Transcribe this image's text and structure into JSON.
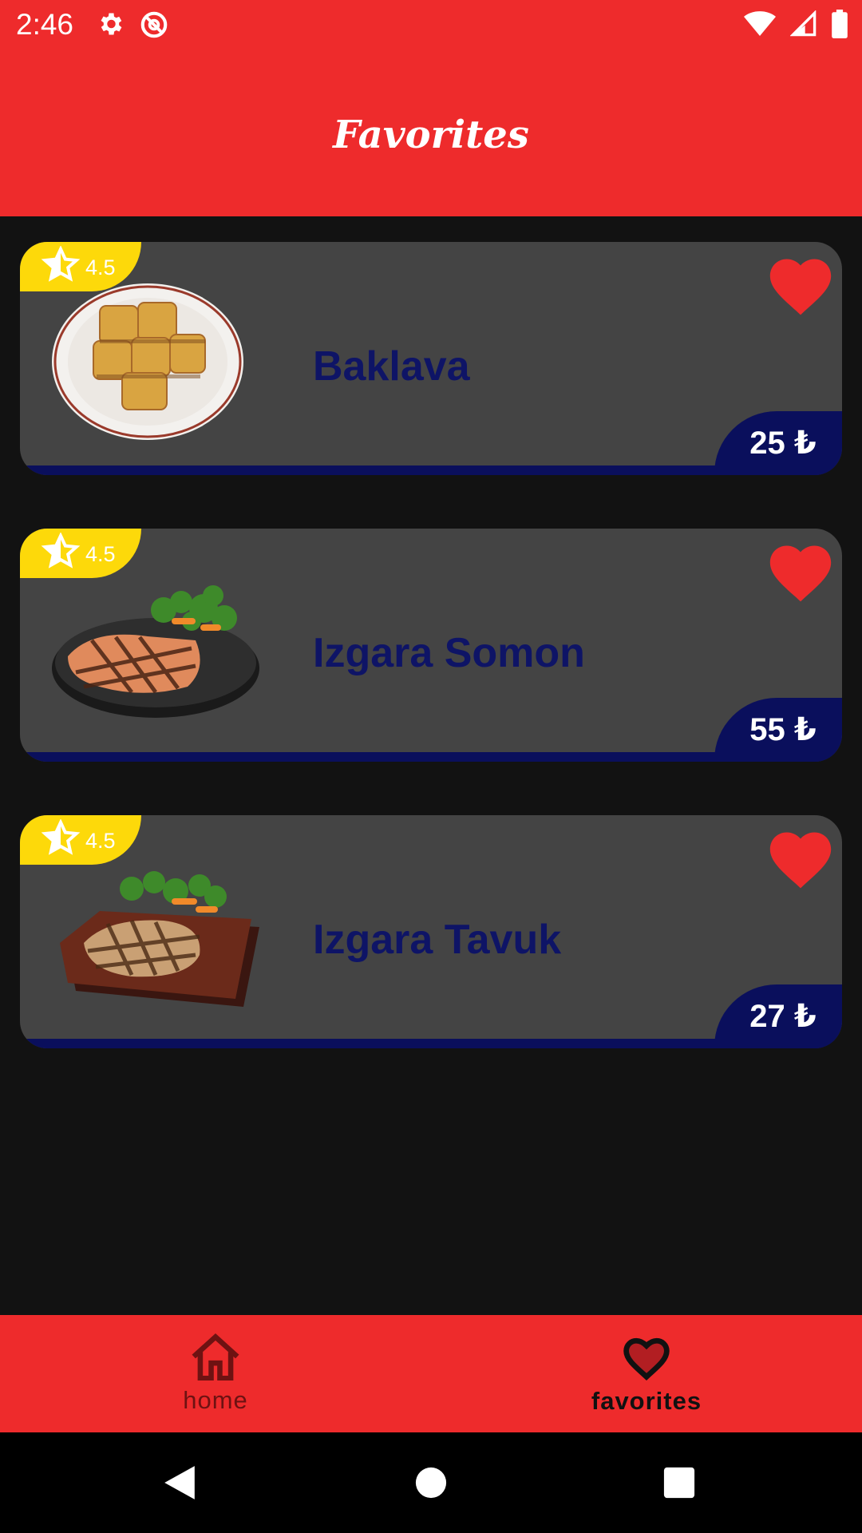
{
  "status_bar": {
    "time": "2:46",
    "left_icons": [
      "gear-icon",
      "at-sign-icon"
    ],
    "right_icons": [
      "wifi-icon",
      "cell-signal-icon",
      "battery-icon"
    ]
  },
  "app_bar": {
    "title": "Favorites"
  },
  "colors": {
    "primary": "#EE2B2C",
    "background": "#121212",
    "card": "#444444",
    "accent_navy": "#0A0F5C",
    "rating_yellow": "#FDD90A",
    "heart_red": "#EE2B2C"
  },
  "favorites": [
    {
      "name": "Baklava",
      "price": "25 ₺",
      "rating": "4.5",
      "image": "baklava-plate-image",
      "favorited": true
    },
    {
      "name": "Izgara Somon",
      "price": "55 ₺",
      "rating": "4.5",
      "image": "grilled-salmon-plate-image",
      "favorited": true
    },
    {
      "name": "Izgara Tavuk",
      "price": "27 ₺",
      "rating": "4.5",
      "image": "grilled-chicken-board-image",
      "favorited": true
    }
  ],
  "bottom_nav": {
    "items": [
      {
        "label": "home",
        "icon": "home-icon",
        "active": false
      },
      {
        "label": "favorites",
        "icon": "heart-outline-icon",
        "active": true
      }
    ]
  },
  "system_nav": [
    "back-icon",
    "home-circle-icon",
    "recents-square-icon"
  ]
}
